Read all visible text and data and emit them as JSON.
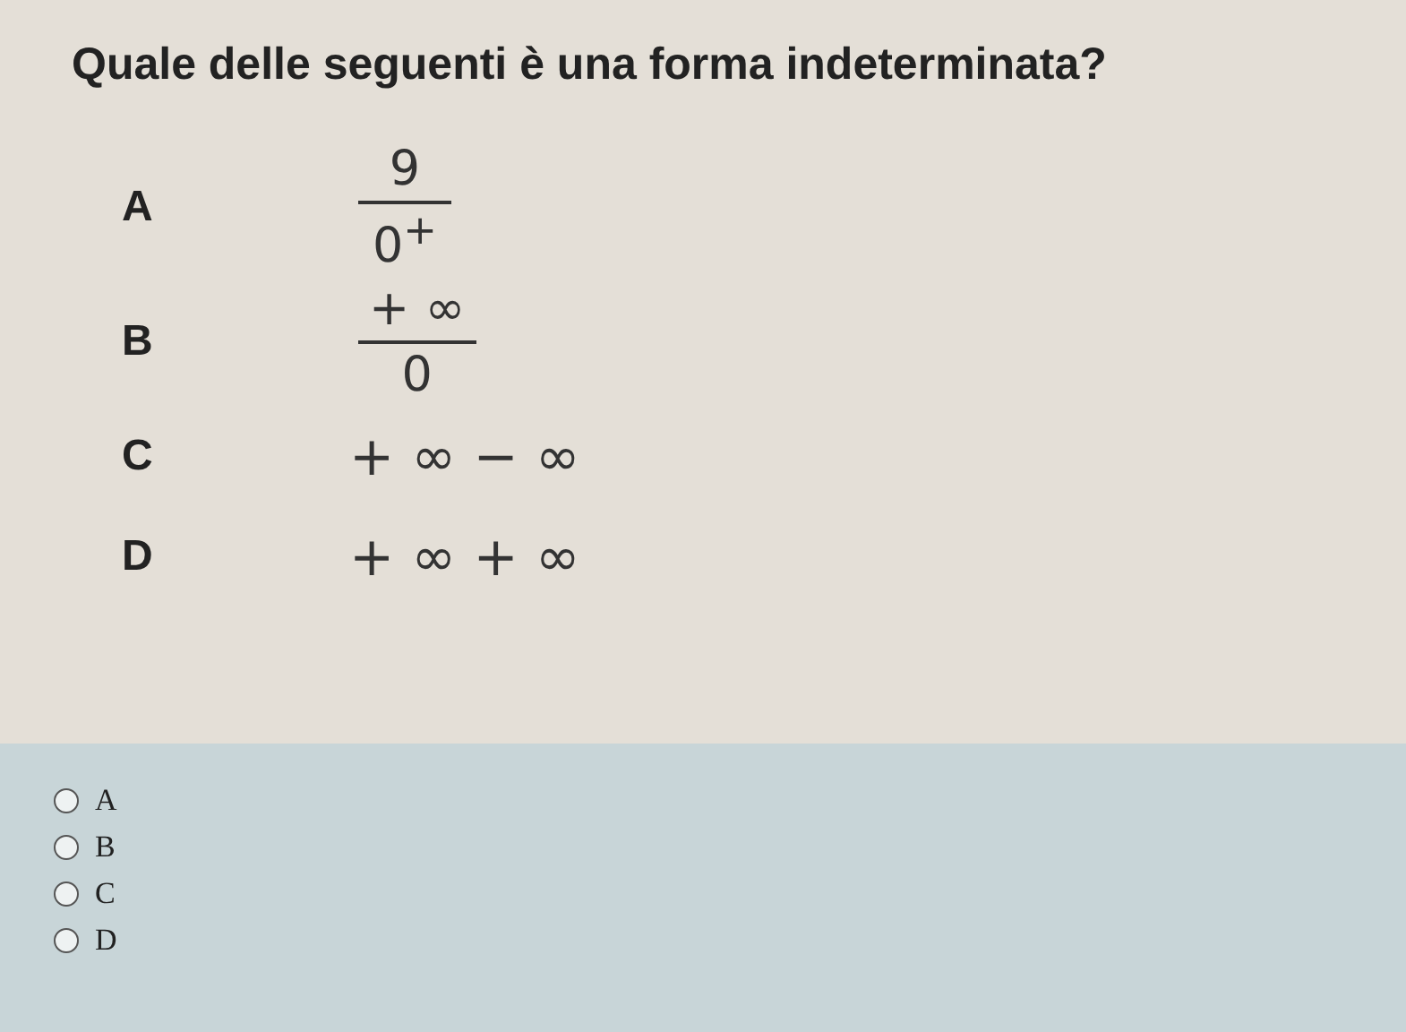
{
  "question": "Quale delle seguenti è una forma indeterminata?",
  "options": [
    {
      "letter": "A",
      "kind": "fraction",
      "numerator": "9",
      "denominator": "0$^{+}$"
    },
    {
      "letter": "B",
      "kind": "fraction",
      "numerator": "+ ∞",
      "denominator": "0"
    },
    {
      "letter": "C",
      "kind": "expression",
      "text": "+ ∞ − ∞"
    },
    {
      "letter": "D",
      "kind": "expression",
      "text": "+ ∞ + ∞"
    }
  ],
  "choices": [
    {
      "label": "A",
      "selected": false
    },
    {
      "label": "B",
      "selected": false
    },
    {
      "label": "C",
      "selected": false
    },
    {
      "label": "D",
      "selected": false
    }
  ]
}
